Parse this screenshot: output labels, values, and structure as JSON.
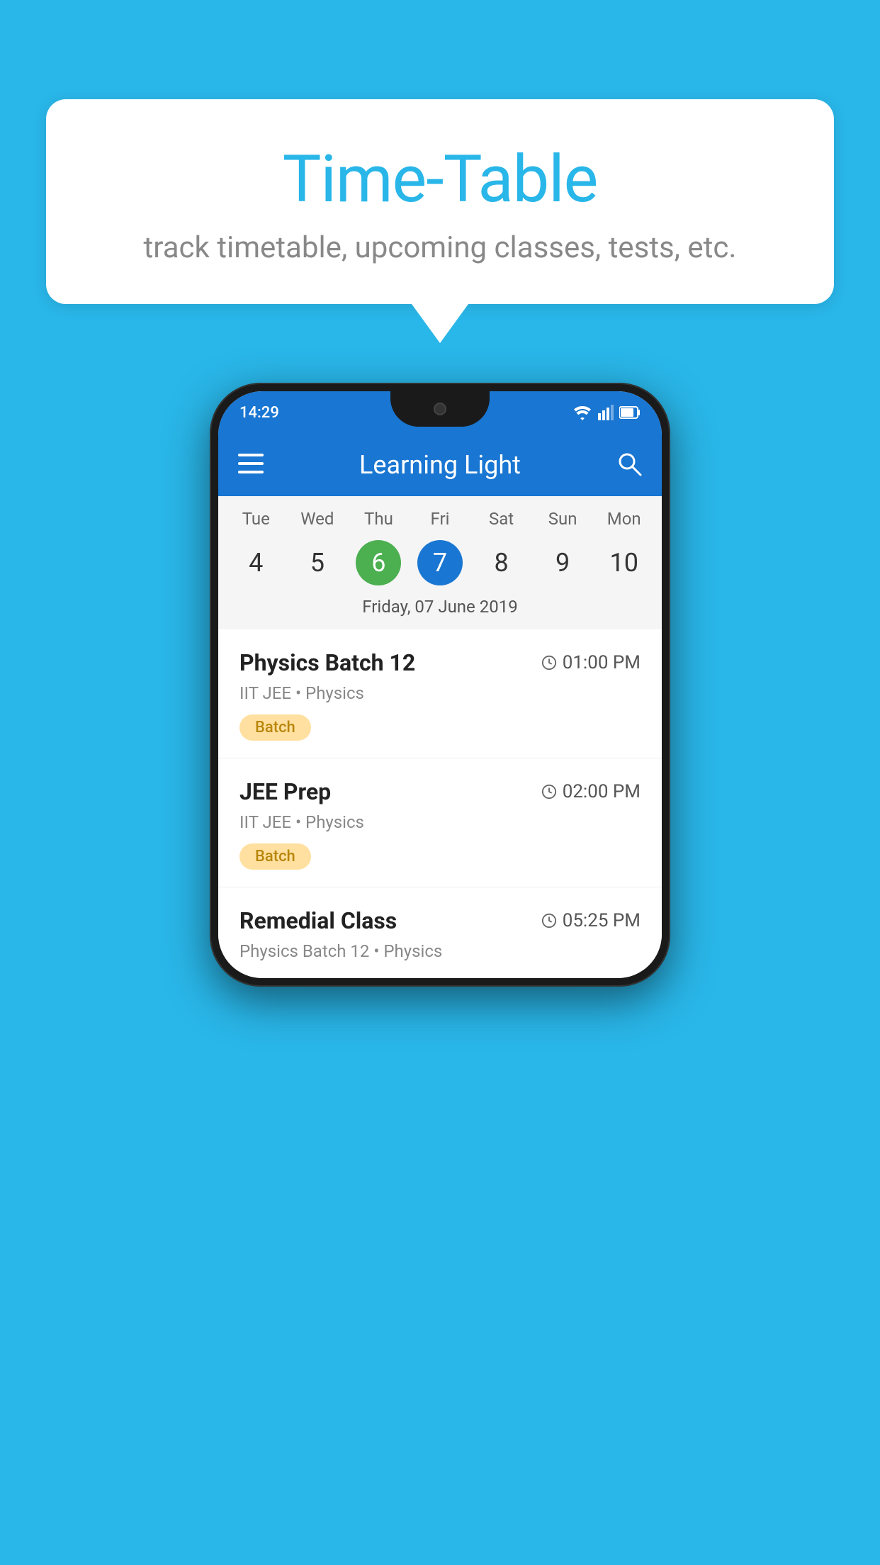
{
  "background_color": "#29B6E8",
  "speech_bubble": {
    "title": "Time-Table",
    "subtitle": "track timetable, upcoming classes, tests, etc."
  },
  "phone": {
    "status_bar": {
      "time": "14:29"
    },
    "app_bar": {
      "title": "Learning Light"
    },
    "calendar": {
      "days": [
        "Tue",
        "Wed",
        "Thu",
        "Fri",
        "Sat",
        "Sun",
        "Mon"
      ],
      "dates": [
        4,
        5,
        6,
        7,
        8,
        9,
        10
      ],
      "today_index": 2,
      "selected_index": 3,
      "date_label": "Friday, 07 June 2019"
    },
    "classes": [
      {
        "name": "Physics Batch 12",
        "time": "01:00 PM",
        "subject": "IIT JEE • Physics",
        "tag": "Batch"
      },
      {
        "name": "JEE Prep",
        "time": "02:00 PM",
        "subject": "IIT JEE • Physics",
        "tag": "Batch"
      },
      {
        "name": "Remedial Class",
        "time": "05:25 PM",
        "subject": "Physics Batch 12 • Physics",
        "tag": null
      }
    ]
  }
}
